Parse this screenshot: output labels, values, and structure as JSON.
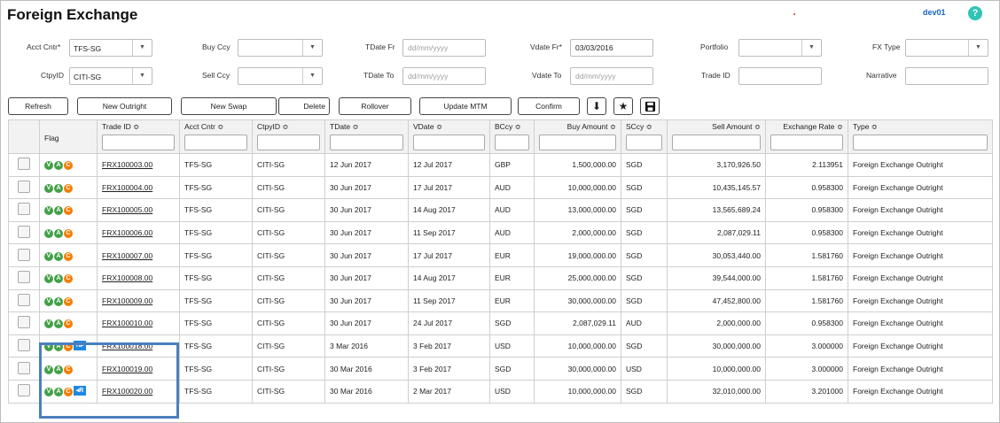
{
  "title": "Foreign Exchange",
  "user": "dev01",
  "help": "?",
  "filters": {
    "acct_cntr": {
      "label": "Acct Cntr*",
      "value": "TFS-SG"
    },
    "ctpy_id": {
      "label": "CtpyID",
      "value": "CITI-SG"
    },
    "buy_ccy": {
      "label": "Buy Ccy",
      "value": ""
    },
    "sell_ccy": {
      "label": "Sell Ccy",
      "value": ""
    },
    "tdate_fr": {
      "label": "TDate Fr",
      "placeholder": "dd/mm/yyyy"
    },
    "tdate_to": {
      "label": "TDate To",
      "placeholder": "dd/mm/yyyy"
    },
    "vdate_fr": {
      "label": "Vdate Fr*",
      "value": "03/03/2016"
    },
    "vdate_to": {
      "label": "Vdate To",
      "placeholder": "dd/mm/yyyy"
    },
    "portfolio": {
      "label": "Portfolio",
      "value": ""
    },
    "trade_id": {
      "label": "Trade ID",
      "value": ""
    },
    "fx_type": {
      "label": "FX Type",
      "value": ""
    },
    "narrative": {
      "label": "Narrative",
      "value": ""
    }
  },
  "toolbar": {
    "refresh": "Refresh",
    "new_outright": "New Outright",
    "new_swap": "New Swap",
    "delete": "Delete",
    "rollover": "Rollover",
    "update_mtm": "Update MTM",
    "confirm": "Confirm",
    "download_icon": "download-icon",
    "star_icon": "star-icon",
    "save_icon": "save-icon"
  },
  "columns": [
    "Flag",
    "Trade ID ≎",
    "Acct Cntr ≎",
    "CtpyID ≎",
    "TDate ≎",
    "VDate ≎",
    "BCcy ≎",
    "Buy Amount ≎",
    "SCcy ≎",
    "Sell Amount ≎",
    "Exchange Rate ≎",
    "Type ≎"
  ],
  "flags": {
    "v": "V",
    "a": "A",
    "c": "C",
    "r_fwd": "R▸",
    "r_back": "◂R"
  },
  "rows": [
    {
      "flag": "vac",
      "trade_id": "FRX100003.00",
      "acct": "TFS-SG",
      "ctpy": "CITI-SG",
      "tdate": "12 Jun 2017",
      "vdate": "12 Jul 2017",
      "bccy": "GBP",
      "buy": "1,500,000.00",
      "sccy": "SGD",
      "sell": "3,170,926.50",
      "rate": "2.113951",
      "type": "Foreign Exchange Outright"
    },
    {
      "flag": "vac",
      "trade_id": "FRX100004.00",
      "acct": "TFS-SG",
      "ctpy": "CITI-SG",
      "tdate": "30 Jun 2017",
      "vdate": "17 Jul 2017",
      "bccy": "AUD",
      "buy": "10,000,000.00",
      "sccy": "SGD",
      "sell": "10,435,145.57",
      "rate": "0.958300",
      "type": "Foreign Exchange Outright"
    },
    {
      "flag": "vac",
      "trade_id": "FRX100005.00",
      "acct": "TFS-SG",
      "ctpy": "CITI-SG",
      "tdate": "30 Jun 2017",
      "vdate": "14 Aug 2017",
      "bccy": "AUD",
      "buy": "13,000,000.00",
      "sccy": "SGD",
      "sell": "13,565,689.24",
      "rate": "0.958300",
      "type": "Foreign Exchange Outright"
    },
    {
      "flag": "vac",
      "trade_id": "FRX100006.00",
      "acct": "TFS-SG",
      "ctpy": "CITI-SG",
      "tdate": "30 Jun 2017",
      "vdate": "11 Sep 2017",
      "bccy": "AUD",
      "buy": "2,000,000.00",
      "sccy": "SGD",
      "sell": "2,087,029.11",
      "rate": "0.958300",
      "type": "Foreign Exchange Outright"
    },
    {
      "flag": "vac",
      "trade_id": "FRX100007.00",
      "acct": "TFS-SG",
      "ctpy": "CITI-SG",
      "tdate": "30 Jun 2017",
      "vdate": "17 Jul 2017",
      "bccy": "EUR",
      "buy": "19,000,000.00",
      "sccy": "SGD",
      "sell": "30,053,440.00",
      "rate": "1.581760",
      "type": "Foreign Exchange Outright"
    },
    {
      "flag": "vac",
      "trade_id": "FRX100008.00",
      "acct": "TFS-SG",
      "ctpy": "CITI-SG",
      "tdate": "30 Jun 2017",
      "vdate": "14 Aug 2017",
      "bccy": "EUR",
      "buy": "25,000,000.00",
      "sccy": "SGD",
      "sell": "39,544,000.00",
      "rate": "1.581760",
      "type": "Foreign Exchange Outright"
    },
    {
      "flag": "vac",
      "trade_id": "FRX100009.00",
      "acct": "TFS-SG",
      "ctpy": "CITI-SG",
      "tdate": "30 Jun 2017",
      "vdate": "11 Sep 2017",
      "bccy": "EUR",
      "buy": "30,000,000.00",
      "sccy": "SGD",
      "sell": "47,452,800.00",
      "rate": "1.581760",
      "type": "Foreign Exchange Outright"
    },
    {
      "flag": "vac",
      "trade_id": "FRX100010.00",
      "acct": "TFS-SG",
      "ctpy": "CITI-SG",
      "tdate": "30 Jun 2017",
      "vdate": "24 Jul 2017",
      "bccy": "SGD",
      "buy": "2,087,029.11",
      "sccy": "AUD",
      "sell": "2,000,000.00",
      "rate": "0.958300",
      "type": "Foreign Exchange Outright"
    },
    {
      "flag": "vacr",
      "trade_id": "FRX100018.00",
      "acct": "TFS-SG",
      "ctpy": "CITI-SG",
      "tdate": "3 Mar 2016",
      "vdate": "3 Feb 2017",
      "bccy": "USD",
      "buy": "10,000,000.00",
      "sccy": "SGD",
      "sell": "30,000,000.00",
      "rate": "3.000000",
      "type": "Foreign Exchange Outright"
    },
    {
      "flag": "vac",
      "trade_id": "FRX100019.00",
      "acct": "TFS-SG",
      "ctpy": "CITI-SG",
      "tdate": "30 Mar 2016",
      "vdate": "3 Feb 2017",
      "bccy": "SGD",
      "buy": "30,000,000.00",
      "sccy": "USD",
      "sell": "10,000,000.00",
      "rate": "3.000000",
      "type": "Foreign Exchange Outright"
    },
    {
      "flag": "vacb",
      "trade_id": "FRX100020.00",
      "acct": "TFS-SG",
      "ctpy": "CITI-SG",
      "tdate": "30 Mar 2016",
      "vdate": "2 Mar 2017",
      "bccy": "USD",
      "buy": "10,000,000.00",
      "sccy": "SGD",
      "sell": "32,010,000.00",
      "rate": "3.201000",
      "type": "Foreign Exchange Outright"
    }
  ]
}
